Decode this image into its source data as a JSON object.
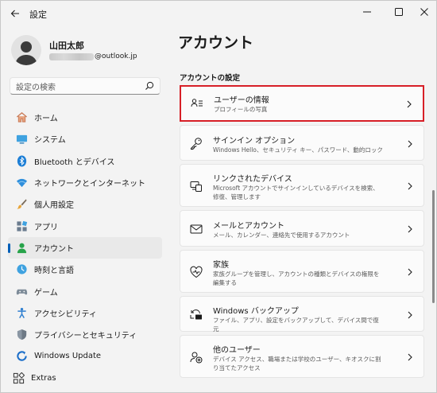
{
  "titlebar": {
    "title": "設定"
  },
  "profile": {
    "name": "山田太郎",
    "email_suffix": "@outlook.jp"
  },
  "search": {
    "placeholder": "設定の検索"
  },
  "sidebar": {
    "items": [
      {
        "label": "ホーム",
        "icon": "home-icon"
      },
      {
        "label": "システム",
        "icon": "system-icon"
      },
      {
        "label": "Bluetooth とデバイス",
        "icon": "bluetooth-icon"
      },
      {
        "label": "ネットワークとインターネット",
        "icon": "wifi-icon"
      },
      {
        "label": "個人用設定",
        "icon": "brush-icon"
      },
      {
        "label": "アプリ",
        "icon": "apps-icon"
      },
      {
        "label": "アカウント",
        "icon": "account-icon",
        "active": true
      },
      {
        "label": "時刻と言語",
        "icon": "globe-clock-icon"
      },
      {
        "label": "ゲーム",
        "icon": "gamepad-icon"
      },
      {
        "label": "アクセシビリティ",
        "icon": "accessibility-icon"
      },
      {
        "label": "プライバシーとセキュリティ",
        "icon": "shield-icon"
      },
      {
        "label": "Windows Update",
        "icon": "update-icon"
      },
      {
        "label": "Extras",
        "icon": "extras-icon"
      }
    ]
  },
  "main": {
    "title": "アカウント",
    "section_title": "アカウントの設定",
    "cards": [
      {
        "title": "ユーザーの情報",
        "desc": "プロフィールの写真",
        "icon": "user-info-icon",
        "highlighted": true
      },
      {
        "title": "サインイン オプション",
        "desc": "Windows Hello、セキュリティ キー、パスワード、動的ロック",
        "icon": "key-icon"
      },
      {
        "title": "リンクされたデバイス",
        "desc": "Microsoft アカウントでサインインしているデバイスを検索、修復、管理します",
        "icon": "linked-devices-icon"
      },
      {
        "title": "メールとアカウント",
        "desc": "メール、カレンダー、連絡先で使用するアカウント",
        "icon": "mail-icon"
      },
      {
        "title": "家族",
        "desc": "家族グループを管理し、アカウントの種類とデバイスの権限を編集する",
        "icon": "family-heart-icon"
      },
      {
        "title": "Windows バックアップ",
        "desc": "ファイル、アプリ、設定をバックアップして、デバイス間で復元",
        "icon": "backup-icon"
      },
      {
        "title": "他のユーザー",
        "desc": "デバイス アクセス、職場または学校のユーザー、キオスクに割り当てたアクセス",
        "icon": "other-users-icon"
      }
    ]
  },
  "colors": {
    "accent": "#005fb8",
    "highlight_border": "#d71f27"
  }
}
